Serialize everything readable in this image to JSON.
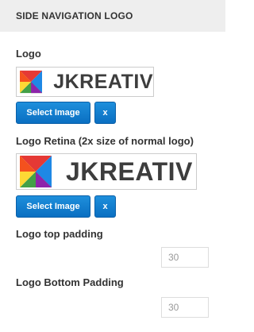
{
  "section": {
    "title": "SIDE NAVIGATION LOGO"
  },
  "logo": {
    "label": "Logo",
    "brand_text": "JKREATIV",
    "select_label": "Select Image",
    "remove_label": "x"
  },
  "logo_retina": {
    "label": "Logo Retina (2x size of normal logo)",
    "brand_text": "JKREATIV",
    "select_label": "Select Image",
    "remove_label": "x"
  },
  "top_padding": {
    "label": "Logo top padding",
    "value": "30"
  },
  "bottom_padding": {
    "label": "Logo Bottom Padding",
    "value": "30"
  },
  "colors": {
    "button_blue": "#0a6fc2",
    "header_bg": "#eeeeee",
    "logo_red": "#e53935",
    "logo_yellow": "#fdd835",
    "logo_green": "#43a047",
    "logo_blue": "#1e88e5"
  }
}
